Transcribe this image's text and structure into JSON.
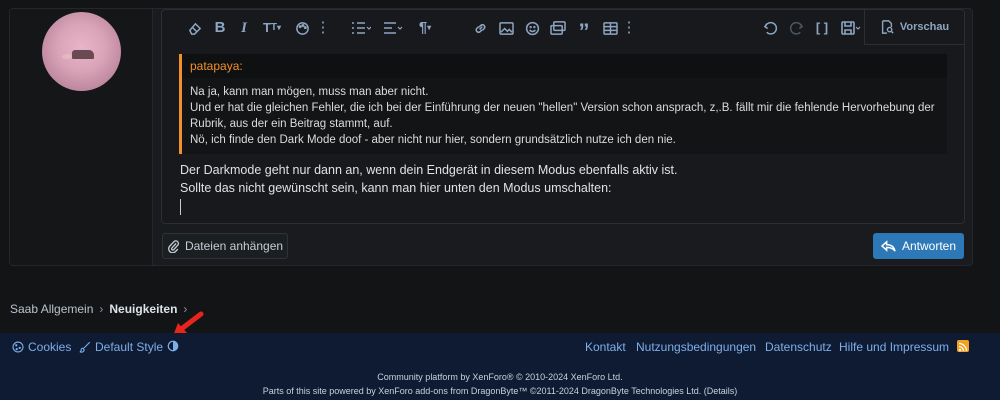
{
  "quote": {
    "author": "patapaya:",
    "lines": [
      "Na ja, kann man mögen, muss man aber nicht.",
      "Und er hat die gleichen Fehler, die ich bei der Einführung der neuen \"hellen\" Version schon ansprach, z,.B. fällt mir die fehlende Hervorhebung der",
      "Rubrik, aus der ein Beitrag stammt, auf.",
      "Nö, ich finde den Dark Mode doof - aber nicht nur hier, sondern grundsätzlich nutze ich den nie."
    ]
  },
  "message": {
    "lines": [
      "Der Darkmode geht nur dann an, wenn dein Endgerät in diesem Modus ebenfalls aktiv ist.",
      "Sollte das nicht gewünscht sein, kann man hier unten den Modus umschalten:"
    ]
  },
  "toolbar": {
    "preview_label": "Vorschau",
    "icons": [
      "eraser-icon",
      "bold-icon",
      "italic-icon",
      "text-size-icon",
      "palette-icon",
      "more-vertical-icon",
      "list-icon",
      "align-icon",
      "paragraph-icon",
      "more-vertical-icon",
      "link-icon",
      "image-icon",
      "smilie-icon",
      "media-icon",
      "quote-icon",
      "table-icon",
      "more-vertical-icon",
      "undo-icon",
      "redo-icon",
      "bbcode-toggle-icon",
      "drafts-icon"
    ]
  },
  "actions": {
    "attach_label": "Dateien anhängen",
    "reply_label": "Antworten"
  },
  "breadcrumb": {
    "items": [
      "Saab Allgemein",
      "Neuigkeiten"
    ]
  },
  "footer": {
    "cookies": "Cookies",
    "style": "Default Style",
    "links": [
      "Kontakt",
      "Nutzungsbedingungen",
      "Datenschutz",
      "Hilfe und Impressum"
    ],
    "copyright_1a": "Community platform by XenForo",
    "copyright_1b": "® © 2010-2024 XenForo Ltd.",
    "copyright_2": "Parts of this site powered by XenForo add-ons from DragonByte™ ©2011-2024 DragonByte Technologies Ltd. (Details)"
  },
  "colors": {
    "accent": "#2d78b6",
    "quote_border": "#f0902b",
    "link": "#7eaee8",
    "footer_bg": "#0f1b33",
    "annotation_arrow": "#e8251c"
  }
}
